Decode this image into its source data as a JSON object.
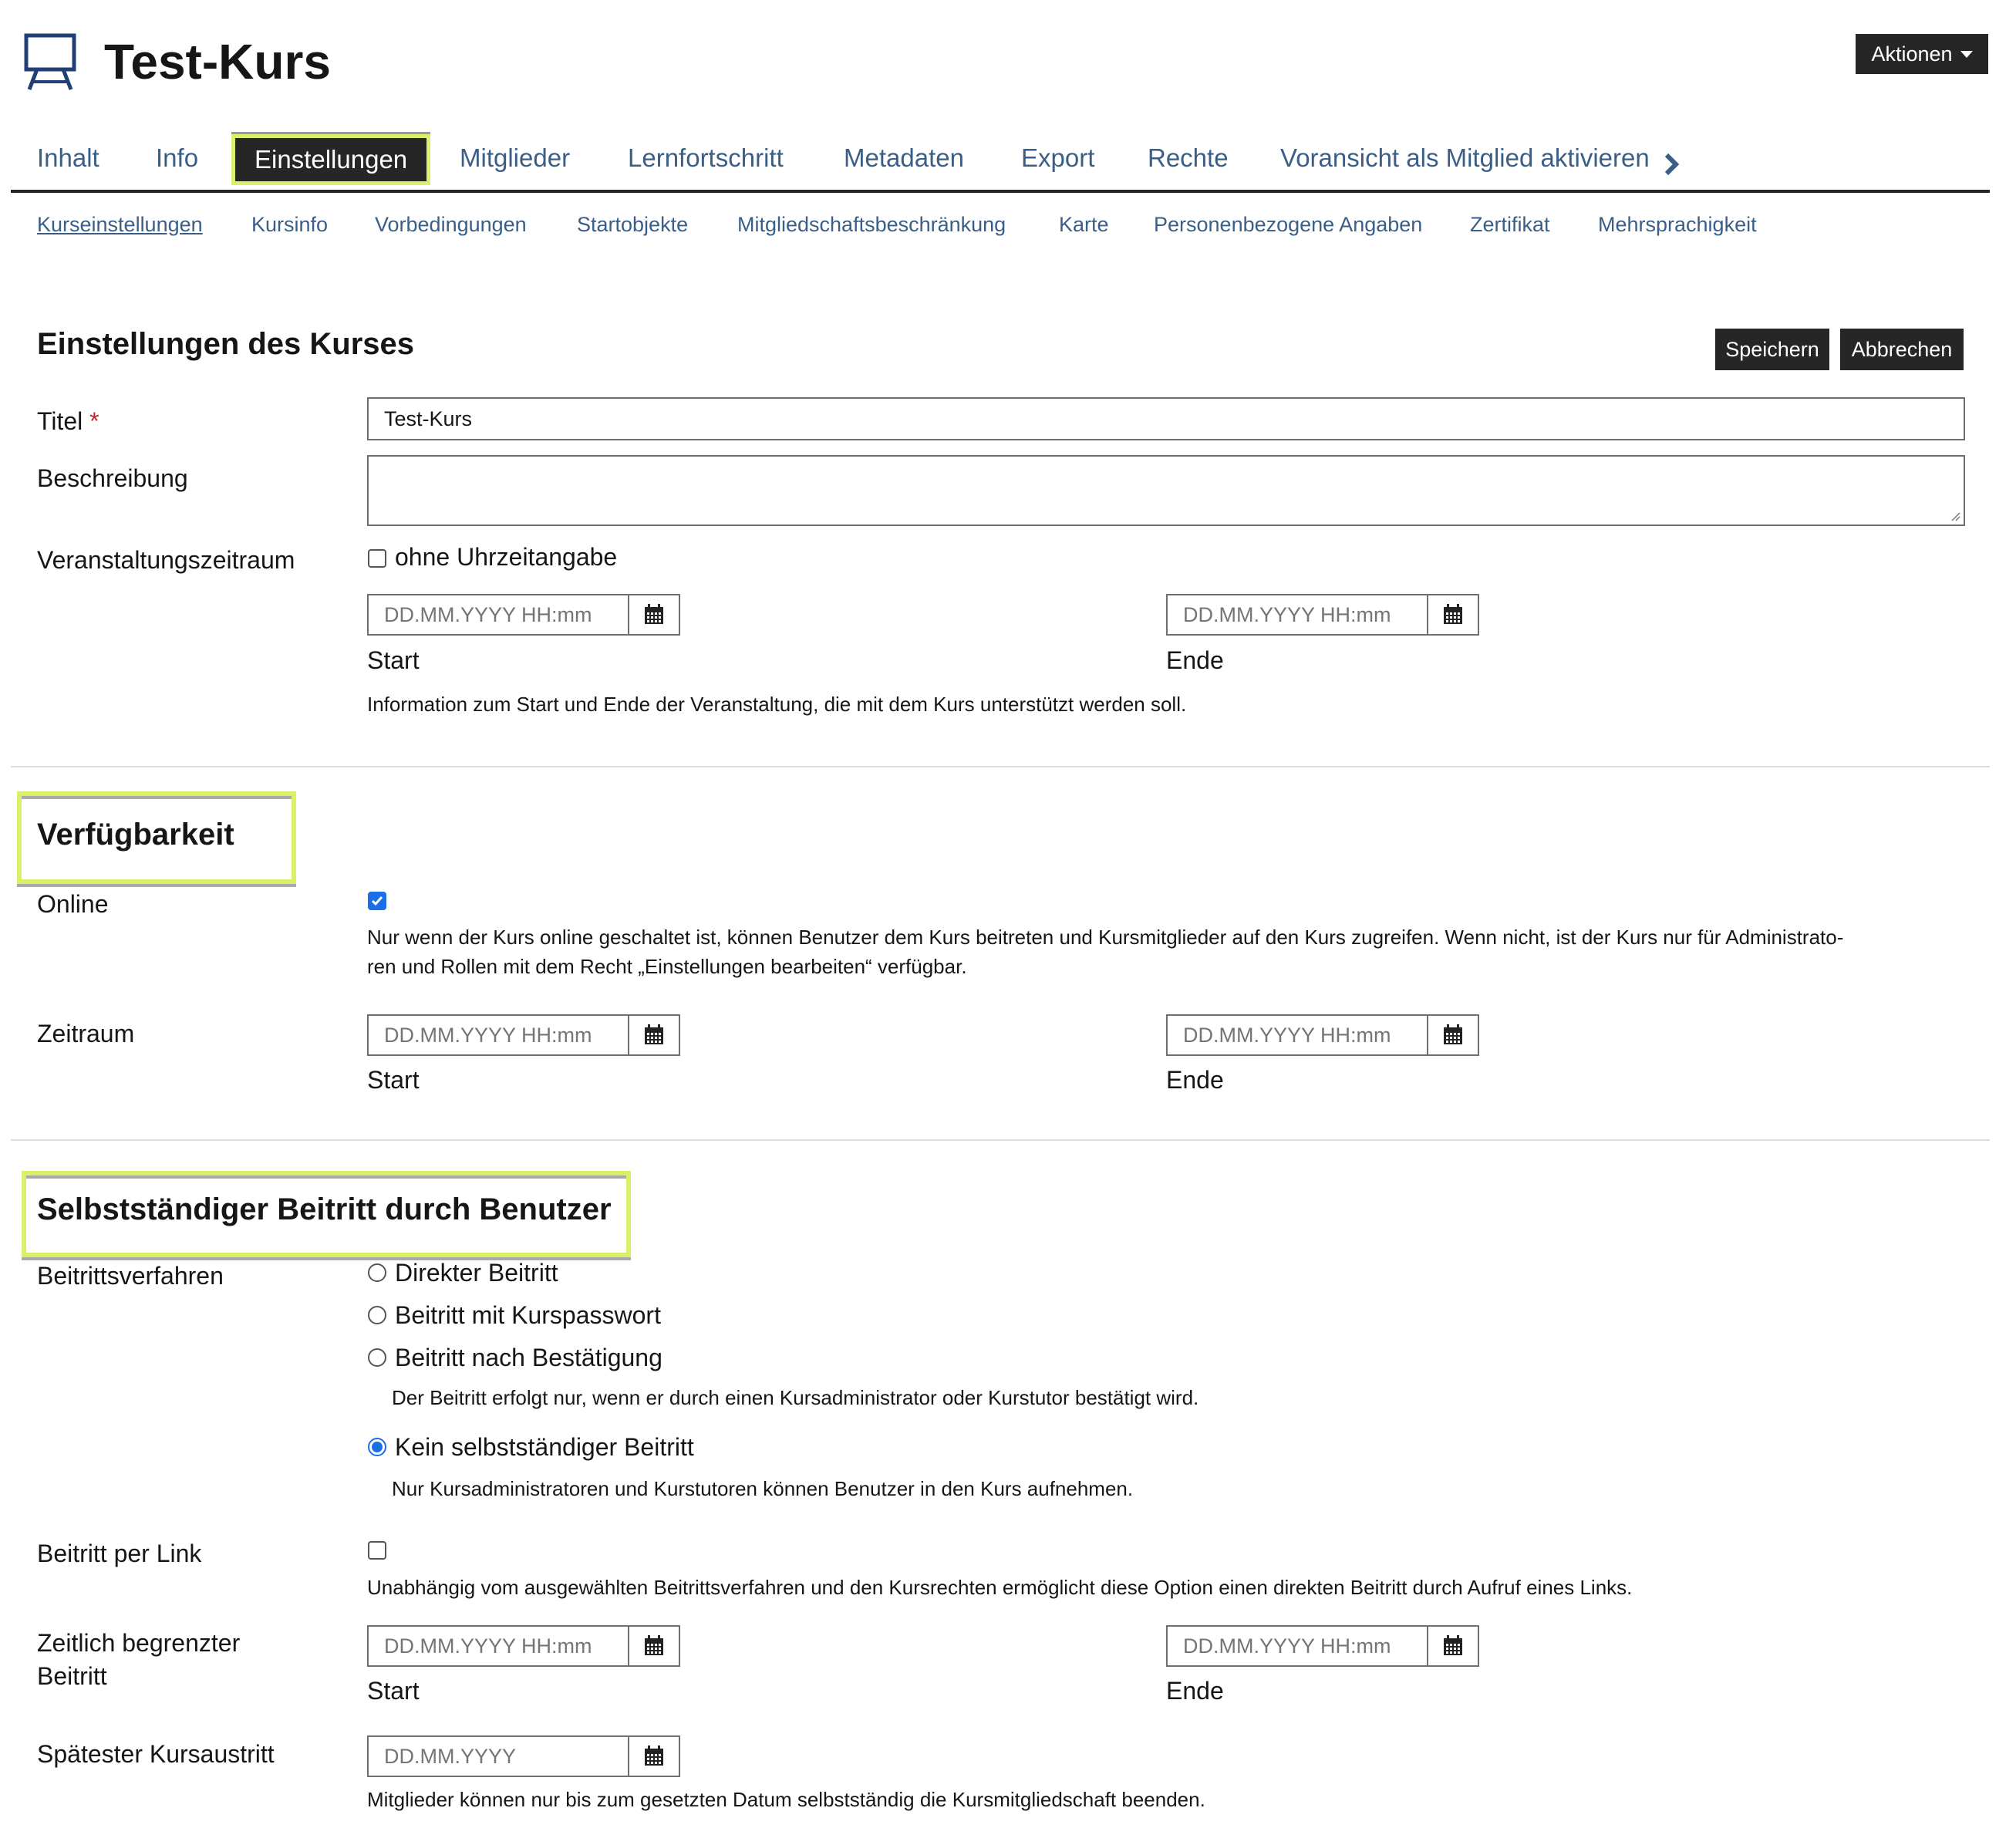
{
  "header": {
    "title": "Test-Kurs",
    "actions_label": "Aktionen"
  },
  "tabs": [
    {
      "label": "Inhalt"
    },
    {
      "label": "Info"
    },
    {
      "label": "Einstellungen",
      "active": true
    },
    {
      "label": "Mitglieder"
    },
    {
      "label": "Lernfortschritt"
    },
    {
      "label": "Metadaten"
    },
    {
      "label": "Export"
    },
    {
      "label": "Rechte"
    },
    {
      "label": "Voransicht als Mitglied aktivieren"
    }
  ],
  "subtabs": [
    {
      "label": "Kurseinstellungen",
      "active": true
    },
    {
      "label": "Kursinfo"
    },
    {
      "label": "Vorbedingungen"
    },
    {
      "label": "Startobjekte"
    },
    {
      "label": "Mitgliedschaftsbeschränkung"
    },
    {
      "label": "Karte"
    },
    {
      "label": "Personenbezogene Angaben"
    },
    {
      "label": "Zertifikat"
    },
    {
      "label": "Mehrsprachigkeit"
    }
  ],
  "form": {
    "heading": "Einstellungen des Kurses",
    "save_label": "Speichern",
    "cancel_label": "Abbrechen",
    "title_label": "Titel",
    "required_mark": "*",
    "title_value": "Test-Kurs",
    "description_label": "Beschreibung",
    "description_value": "",
    "period_label": "Veranstaltungszeitraum",
    "no_time_label": "ohne Uhrzeitangabe",
    "datetime_placeholder": "DD.MM.YYYY HH:mm",
    "date_placeholder": "DD.MM.YYYY",
    "start_label": "Start",
    "end_label": "Ende",
    "period_help": "Information zum Start und Ende der Veranstaltung, die mit dem Kurs unterstützt werden soll."
  },
  "availability": {
    "heading": "Verfügbarkeit",
    "online_label": "Online",
    "online_checked": true,
    "online_help": "Nur wenn der Kurs online geschaltet ist, können Benutzer dem Kurs beitreten und Kursmitglieder auf den Kurs zugreifen. Wenn nicht, ist der Kurs nur für Administrato-ren und Rollen mit dem Recht „Einstellungen bearbeiten“ verfügbar.",
    "online_help_line1": "Nur wenn der Kurs online geschaltet ist, können Benutzer dem Kurs beitreten und Kursmitglieder auf den Kurs zugreifen. Wenn nicht, ist der Kurs nur für Administrato-",
    "online_help_line2": "ren und Rollen mit dem Recht „Einstellungen bearbeiten“ verfügbar.",
    "period_label": "Zeitraum"
  },
  "registration": {
    "heading": "Selbstständiger Beitritt durch Benutzer",
    "procedure_label": "Beitrittsverfahren",
    "options": [
      {
        "label": "Direkter Beitritt",
        "checked": false,
        "help": ""
      },
      {
        "label": "Beitritt mit Kurspasswort",
        "checked": false,
        "help": ""
      },
      {
        "label": "Beitritt nach Bestätigung",
        "checked": false,
        "help": "Der Beitritt erfolgt nur, wenn er durch einen Kursadministrator oder Kurstutor bestätigt wird."
      },
      {
        "label": "Kein selbstständiger Beitritt",
        "checked": true,
        "help": "Nur Kursadministratoren und Kurstutoren können Benutzer in den Kurs aufnehmen."
      }
    ],
    "link_label": "Beitritt per Link",
    "link_help": "Unabhängig vom ausgewählten Beitrittsverfahren und den Kursrechten ermöglicht diese Option einen direkten Beitritt durch Aufruf eines Links.",
    "limited_label_line1": "Zeitlich begrenzter",
    "limited_label_line2": "Beitritt",
    "latest_exit_label": "Spätester Kursaustritt",
    "latest_exit_help": "Mitglieder können nur bis zum gesetzten Datum selbstständig die Kursmitgliedschaft beenden."
  },
  "colors": {
    "link": "#3a5e86",
    "dark": "#262626",
    "highlight": "#d9f06a",
    "check": "#1a6ee6"
  }
}
